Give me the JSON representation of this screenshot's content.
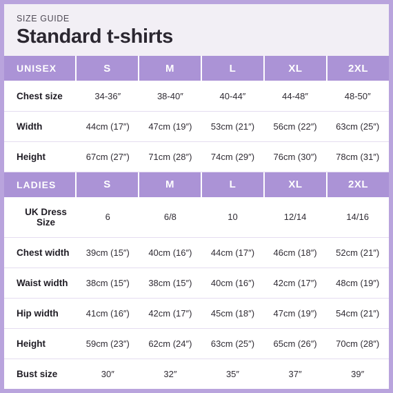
{
  "header": {
    "eyebrow": "SIZE GUIDE",
    "title": "Standard t-shirts"
  },
  "colors": {
    "accent_purple": "#ab93d6",
    "border_purple": "#b9a4dd",
    "title_background": "#f2eff5",
    "row_divider": "#e4dcf0",
    "text_dark": "#2f2b33",
    "header_text": "#ffffff"
  },
  "sections": [
    {
      "name": "unisex",
      "header": {
        "label": "UNISEX",
        "sizes": [
          "S",
          "M",
          "L",
          "XL",
          "2XL"
        ]
      },
      "rows": [
        {
          "label": "Chest size",
          "values": [
            "34-36″",
            "38-40″",
            "40-44″",
            "44-48″",
            "48-50″"
          ]
        },
        {
          "label": "Width",
          "values": [
            "44cm (17″)",
            "47cm (19″)",
            "53cm (21″)",
            "56cm (22″)",
            "63cm (25″)"
          ]
        },
        {
          "label": "Height",
          "values": [
            "67cm (27″)",
            "71cm (28″)",
            "74cm (29″)",
            "76cm (30″)",
            "78cm (31″)"
          ]
        }
      ]
    },
    {
      "name": "ladies",
      "header": {
        "label": "LADIES",
        "sizes": [
          "S",
          "M",
          "L",
          "XL",
          "2XL"
        ]
      },
      "rows": [
        {
          "label": "UK Dress Size",
          "values": [
            "6",
            "6/8",
            "10",
            "12/14",
            "14/16"
          ]
        },
        {
          "label": "Chest width",
          "values": [
            "39cm (15″)",
            "40cm (16″)",
            "44cm (17″)",
            "46cm (18″)",
            "52cm (21″)"
          ]
        },
        {
          "label": "Waist width",
          "values": [
            "38cm (15″)",
            "38cm (15″)",
            "40cm (16″)",
            "42cm (17″)",
            "48cm (19″)"
          ]
        },
        {
          "label": "Hip width",
          "values": [
            "41cm (16″)",
            "42cm (17″)",
            "45cm (18″)",
            "47cm (19″)",
            "54cm (21″)"
          ]
        },
        {
          "label": "Height",
          "values": [
            "59cm (23″)",
            "62cm (24″)",
            "63cm (25″)",
            "65cm (26″)",
            "70cm (28″)"
          ]
        },
        {
          "label": "Bust size",
          "values": [
            "30″",
            "32″",
            "35″",
            "37″",
            "39″"
          ]
        }
      ]
    }
  ]
}
